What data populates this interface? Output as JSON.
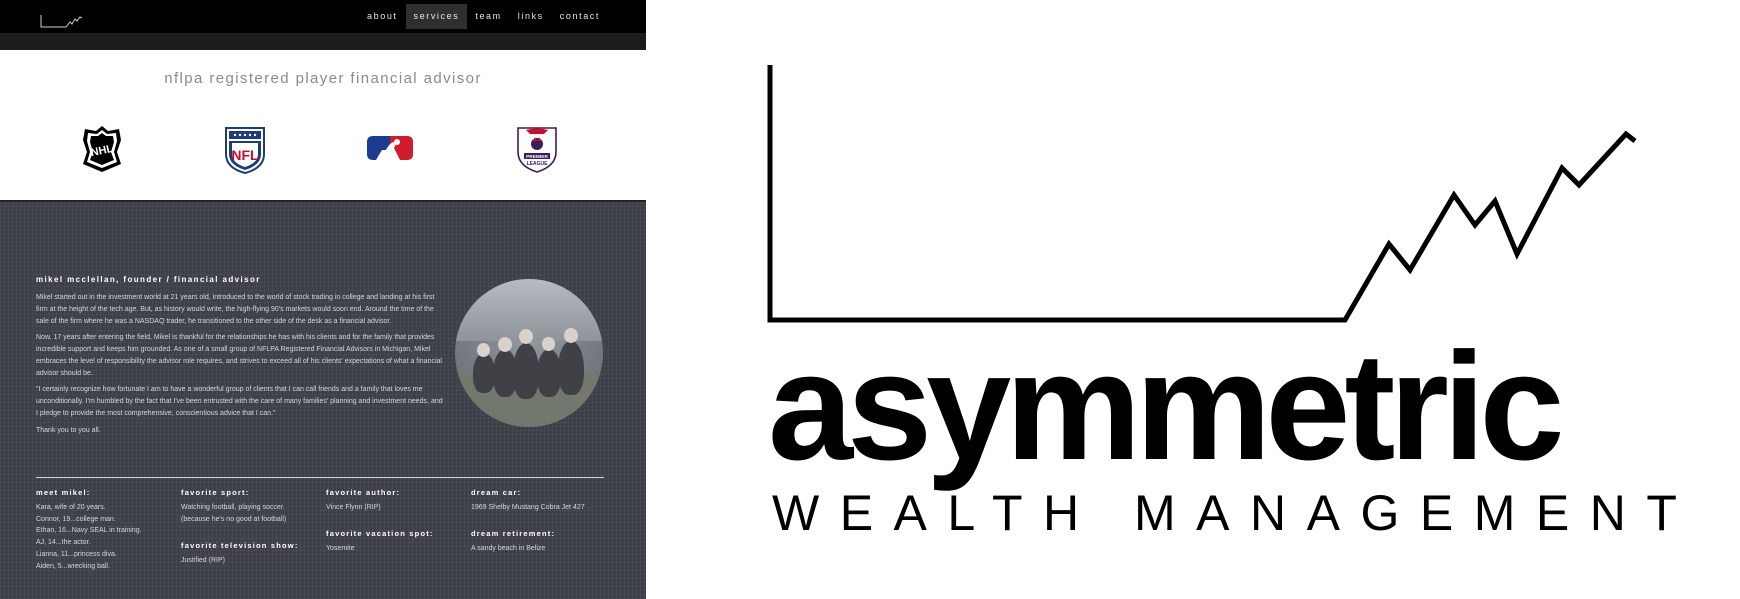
{
  "nav": {
    "items": [
      "about",
      "services",
      "team",
      "links",
      "contact"
    ],
    "active": "services"
  },
  "tagline": "nflpa registered player financial advisor",
  "leagues": [
    "NHL",
    "NFL",
    "MLB",
    "PREMIER LEAGUE"
  ],
  "founder": {
    "title": "mikel mcclellan, founder / financial advisor",
    "bio1": "Mikel started out in the investment world at 21 years old, introduced to the world of stock trading in college and landing at his first firm at the height of the tech age. But, as history would write, the high-flying 90's markets would soon end. Around the time of the sale of the firm where he was a NASDAQ trader, he transitioned to the other side of the desk as a financial advisor.",
    "bio2": "Now, 17 years after entering the field, Mikel is thankful for the relationships he has with his clients and for the family that provides incredible support and keeps him grounded. As one of a small group of NFLPA Registered Financial Advisors in Michigan, Mikel embraces the level of responsibility the advisor role requires, and strives to exceed all of his clients' expectations of what a financial advisor should be.",
    "bio3": "\"I certainly recognize how fortunate I am to have a wonderful group of clients that I can call friends and a family that loves me unconditionally. I'm humbled by the fact that I've been entrusted with the care of many families' planning and investment needs, and I pledge to provide the most comprehensive, conscientious advice that I can.\"",
    "bio4": "Thank you to you all."
  },
  "facts": {
    "meet_heading": "meet mikel:",
    "family": [
      "Kara, wife of 20 years.",
      "Connor, 19...college man.",
      "Ethan, 16...Navy SEAL in training.",
      "AJ, 14...the actor.",
      "Lianna, 11...princess diva.",
      "Aiden, 5...wrecking ball."
    ],
    "sport_heading": "favorite sport:",
    "sport_line1": "Watching football, playing soccer.",
    "sport_line2": "(because he's no good at football)",
    "tv_heading": "favorite television show:",
    "tv": "Justified (RIP)",
    "author_heading": "favorite author:",
    "author": "Vince Flynn (RIP)",
    "vacation_heading": "favorite vacation spot:",
    "vacation": "Yosemite",
    "car_heading": "dream car:",
    "car": "1969 Shelby Mustang Cobra Jet 427",
    "retirement_heading": "dream retirement:",
    "retirement": "A sandy beach in Belize"
  },
  "brand": {
    "name": "asymmetric",
    "subtitle": "WEALTH MANAGEMENT"
  },
  "colors": {
    "nav_bg": "#000000",
    "panel_bg": "#3d4048",
    "tagline": "#8a8a8a",
    "logo": "#000000"
  }
}
